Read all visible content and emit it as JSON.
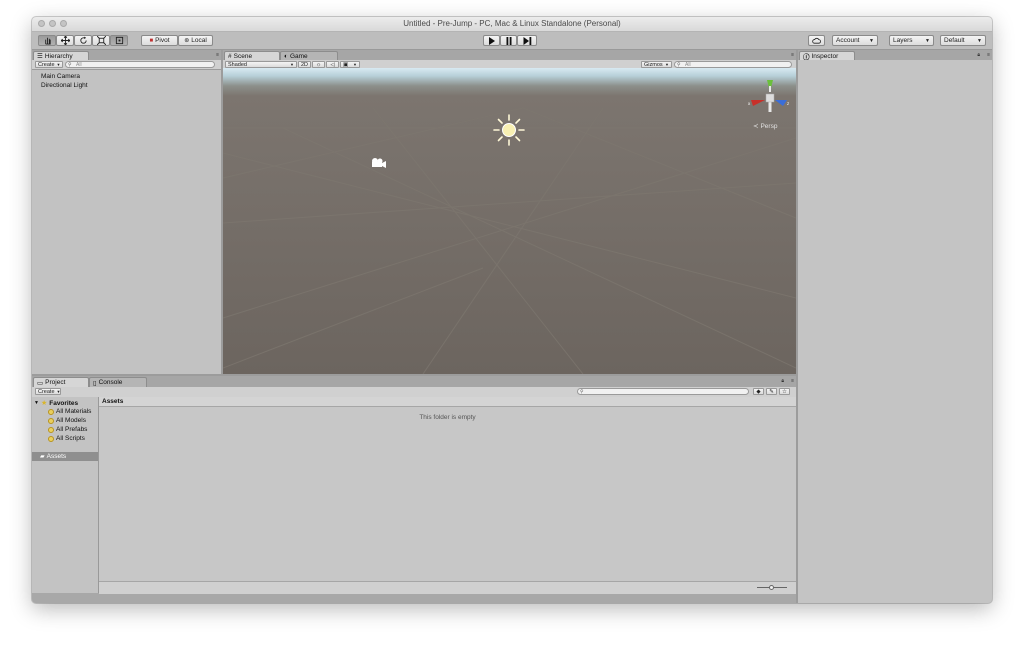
{
  "window": {
    "title": "Untitled - Pre-Jump - PC, Mac & Linux Standalone (Personal)"
  },
  "toolbar": {
    "pivot_label": "Pivot",
    "local_label": "Local",
    "account_label": "Account",
    "layers_label": "Layers",
    "layout_label": "Default"
  },
  "hierarchy": {
    "tab_label": "Hierarchy",
    "create_label": "Create",
    "search_placeholder": "All",
    "items": [
      "Main Camera",
      "Directional Light"
    ]
  },
  "scene": {
    "tab_label": "Scene",
    "game_tab_label": "Game",
    "shading_label": "Shaded",
    "mode_2d_label": "2D",
    "gizmos_label": "Gizmos",
    "search_placeholder": "All",
    "persp_label": "Persp",
    "axis_x": "x",
    "axis_z": "z"
  },
  "inspector": {
    "tab_label": "Inspector"
  },
  "project": {
    "tab_label": "Project",
    "console_tab_label": "Console",
    "create_label": "Create",
    "favorites_label": "Favorites",
    "favorites": [
      "All Materials",
      "All Models",
      "All Prefabs",
      "All Scripts"
    ],
    "assets_root_label": "Assets",
    "breadcrumb": "Assets",
    "empty_message": "This folder is empty"
  },
  "colors": {
    "accent_selection": "#8f8f8f",
    "axis_x": "#c8302a",
    "axis_y": "#6bc03c",
    "axis_z": "#3b6ed9"
  }
}
